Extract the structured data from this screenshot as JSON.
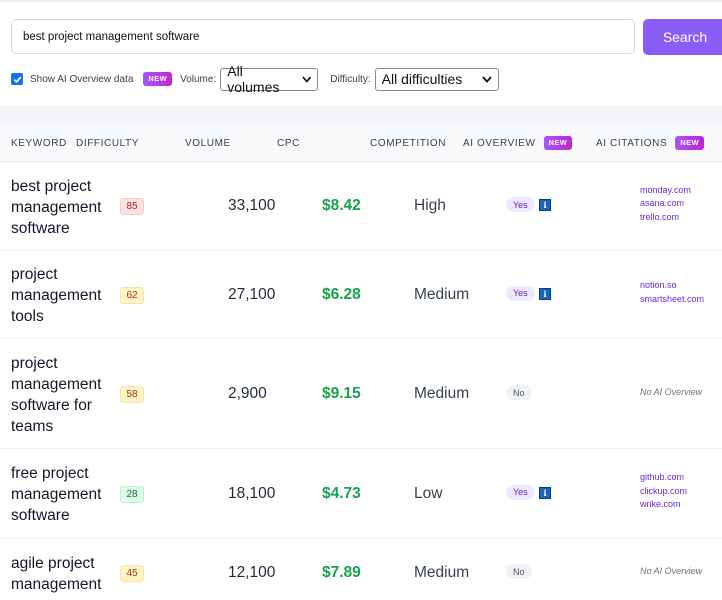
{
  "search": {
    "value": "best project management software",
    "button_label": "Search"
  },
  "filters": {
    "show_ai_label": "Show AI Overview data",
    "show_ai_checked": true,
    "new_badge": "NEW",
    "volume_label": "Volume:",
    "volume_selected": "All volumes",
    "difficulty_label": "Difficulty:",
    "difficulty_selected": "All difficulties"
  },
  "table": {
    "headers": {
      "keyword": "KEYWORD",
      "difficulty": "DIFFICULTY",
      "volume": "VOLUME",
      "cpc": "CPC",
      "competition": "COMPETITION",
      "ai_overview": "AI OVERVIEW",
      "ai_citations": "AI CITATIONS",
      "new_badge": "NEW"
    },
    "no_ai_text": "No AI Overview",
    "rows": [
      {
        "keyword_lines": [
          "best project",
          "management",
          "software"
        ],
        "difficulty": "85",
        "difficulty_level": "red",
        "volume": "33,100",
        "cpc": "$8.42",
        "competition": "High",
        "ai_overview": "Yes",
        "citations": [
          "monday.com",
          "asana.com",
          "trello.com"
        ]
      },
      {
        "keyword_lines": [
          "project",
          "management",
          "tools"
        ],
        "difficulty": "62",
        "difficulty_level": "yellow",
        "volume": "27,100",
        "cpc": "$6.28",
        "competition": "Medium",
        "ai_overview": "Yes",
        "citations": [
          "notion.so",
          "smartsheet.com"
        ]
      },
      {
        "keyword_lines": [
          "project",
          "management",
          "software for",
          "teams"
        ],
        "difficulty": "58",
        "difficulty_level": "yellow",
        "volume": "2,900",
        "cpc": "$9.15",
        "competition": "Medium",
        "ai_overview": "No",
        "citations": []
      },
      {
        "keyword_lines": [
          "free project",
          "management",
          "software"
        ],
        "difficulty": "28",
        "difficulty_level": "green",
        "volume": "18,100",
        "cpc": "$4.73",
        "competition": "Low",
        "ai_overview": "Yes",
        "citations": [
          "github.com",
          "clickup.com",
          "wrike.com"
        ]
      },
      {
        "keyword_lines": [
          "agile project",
          "management"
        ],
        "difficulty": "45",
        "difficulty_level": "yellow",
        "volume": "12,100",
        "cpc": "$7.89",
        "competition": "Medium",
        "ai_overview": "No",
        "citations": []
      }
    ]
  },
  "colors": {
    "accent": "#8b5cf6",
    "cpc_green": "#16a34a",
    "citation_purple": "#6d28d9"
  },
  "icons": {
    "checkbox": "checkbox-checked-icon",
    "dropdown": "chevron-down-icon",
    "info": "info-icon"
  }
}
